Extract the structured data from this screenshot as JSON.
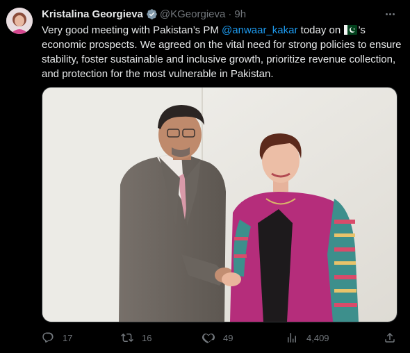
{
  "tweet": {
    "author_name": "Kristalina Georgieva",
    "handle": "@KGeorgieva",
    "separator": "·",
    "time": "9h",
    "text_before_mention": "Very good meeting with Pakistan’s PM ",
    "mention": "@anwaar_kakar",
    "text_after_mention": " today on ",
    "text_after_flag": "’s economic prospects. We agreed on the vital need for strong policies to ensure stability, foster sustainable and inclusive growth, prioritize revenue collection, and protection for the most vulnerable in Pakistan."
  },
  "actions": {
    "replies": "17",
    "retweets": "16",
    "likes": "49",
    "views": "4,409"
  },
  "icons": {
    "verified": "verified-badge-icon",
    "flag": "pakistan-flag-icon",
    "more": "more-options-icon",
    "reply": "reply-icon",
    "retweet": "retweet-icon",
    "like": "heart-icon",
    "views": "views-chart-icon",
    "share": "share-icon"
  },
  "colors": {
    "background": "#000000",
    "text": "#e7e9ea",
    "muted": "#71767b",
    "link": "#1d9bf0"
  }
}
